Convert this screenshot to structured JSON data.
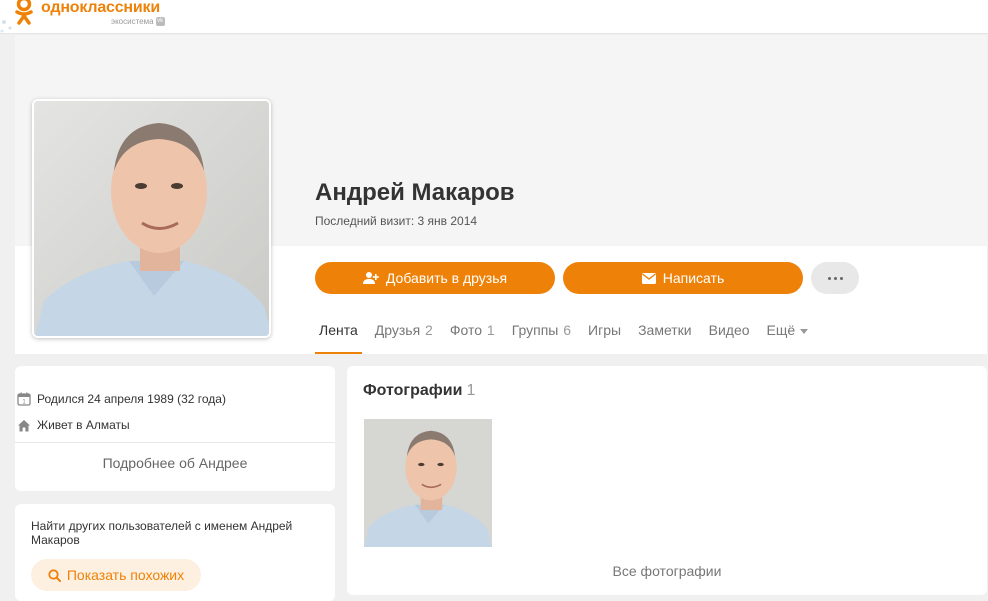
{
  "header": {
    "logo_text": "одноклассники",
    "logo_sub": "экосистема",
    "logo_vk": "vk"
  },
  "profile": {
    "name": "Андрей Макаров",
    "last_visit": "Последний визит: 3 янв 2014",
    "add_friend_label": "Добавить в друзья",
    "message_label": "Написать"
  },
  "tabs": [
    {
      "label": "Лента",
      "count": ""
    },
    {
      "label": "Друзья",
      "count": "2"
    },
    {
      "label": "Фото",
      "count": "1"
    },
    {
      "label": "Группы",
      "count": "6"
    },
    {
      "label": "Игры",
      "count": ""
    },
    {
      "label": "Заметки",
      "count": ""
    },
    {
      "label": "Видео",
      "count": ""
    },
    {
      "label": "Ещё",
      "count": ""
    }
  ],
  "info": {
    "born": "Родился 24 апреля 1989 (32 года)",
    "lives": "Живет в Алматы",
    "more_about": "Подробнее об Андрее"
  },
  "similar": {
    "text": "Найти других пользователей с именем Андрей Макаров",
    "button_label": "Показать похожих"
  },
  "photos": {
    "title": "Фотографии",
    "count": "1",
    "all_label": "Все фотографии"
  },
  "colors": {
    "accent": "#ee8208",
    "accent_light": "#fdf0e0",
    "page_bg": "#f0f0f0"
  }
}
